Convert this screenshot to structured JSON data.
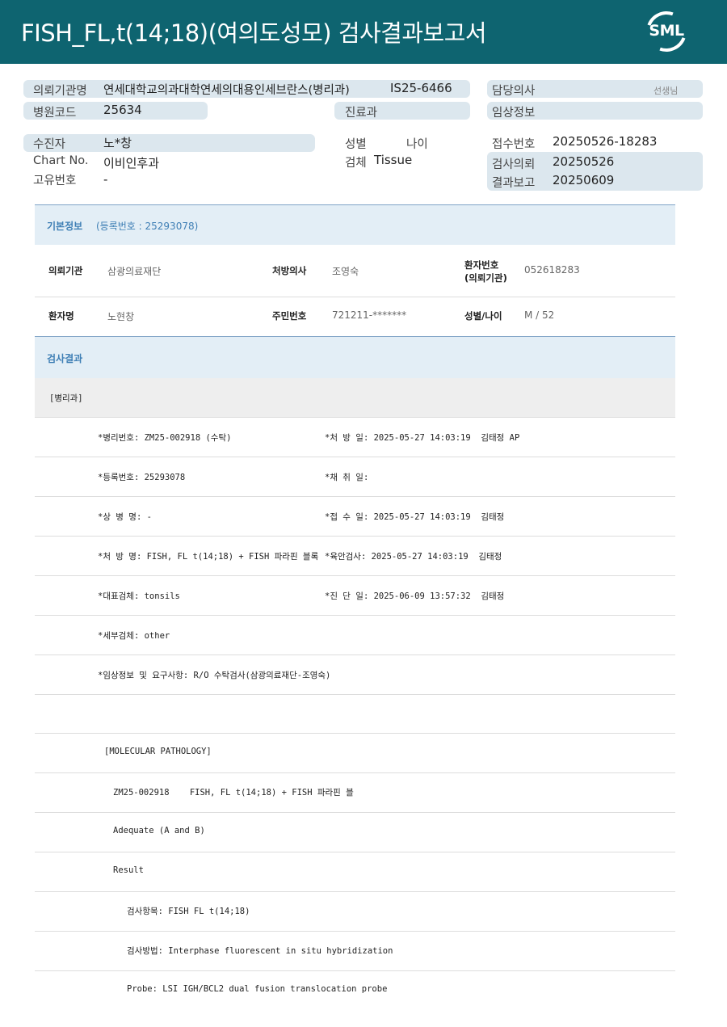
{
  "header": {
    "title": "FISH_FL,t(14;18)(여의도성모) 검사결과보고서",
    "logo_text": "SML"
  },
  "info": {
    "requesting_org_label": "의뢰기관명",
    "requesting_org_value": "연세대학교의과대학연세의대용인세브란스(병리과)",
    "request_code": "IS25-6466",
    "doctor_label": "담당의사",
    "doctor_suffix": "선생님",
    "hospital_code_label": "병원코드",
    "hospital_code_value": "25634",
    "dept_label": "진료과",
    "clinical_info_label": "임상정보",
    "patient_label": "수진자",
    "patient_value": "노*창",
    "sex_label": "성별",
    "age_label": "나이",
    "receipt_no_label": "접수번호",
    "receipt_no_value": "20250526-18283",
    "chart_label": "Chart No.",
    "chart_value": "이비인후과",
    "specimen_label": "검체",
    "specimen_value": "Tissue",
    "test_request_label": "검사의뢰",
    "test_request_value": "20250526",
    "unique_no_label": "고유번호",
    "unique_no_value": "-",
    "result_report_label": "결과보고",
    "result_report_value": "20250609"
  },
  "basic": {
    "title": "기본정보",
    "reg_note": "(등록번호 : 25293078)",
    "org_label": "의뢰기관",
    "org_value": "삼광의료재단",
    "prescriber_label": "처방의사",
    "prescriber_value": "조영숙",
    "patient_no_label_1": "환자번호",
    "patient_no_label_2": "(의뢰기관)",
    "patient_no_value": "052618283",
    "name_label": "환자명",
    "name_value": "노현창",
    "rrn_label": "주민번호",
    "rrn_value": "721211-*******",
    "sex_age_label": "성별/나이",
    "sex_age_value": "M / 52"
  },
  "results": {
    "title": "검사결과",
    "section_label": "[병리과]",
    "rows": [
      {
        "left": "*병리번호: ZM25-002918 (수탁)",
        "right": "*처 방 일: 2025-05-27 14:03:19  김태정 AP"
      },
      {
        "left": "*등록번호: 25293078",
        "right": "*채 취 일:"
      },
      {
        "left": "*상 병 명: -",
        "right": "*접 수 일: 2025-05-27 14:03:19  김태정"
      },
      {
        "left": "*처 방 명: FISH, FL t(14;18) + FISH 파라핀 블록",
        "right": "*육안검사: 2025-05-27 14:03:19  김태정"
      },
      {
        "left": "*대표검체: tonsils",
        "right": "*진 단 일: 2025-06-09 13:57:32  김태정"
      },
      {
        "left": "*세부검체: other",
        "right": ""
      },
      {
        "left": "*임상정보 및 요구사항: R/O 수탁검사(삼광의료재단-조영숙)",
        "right": ""
      }
    ],
    "mol_title": "[MOLECULAR PATHOLOGY]",
    "mol_line": "ZM25-002918    FISH, FL t(14;18) + FISH 파라핀 블",
    "adequate": "Adequate (A and B)",
    "result_label": "Result",
    "test_item": "검사항목: FISH FL t(14;18)",
    "test_method": "검사방법: Interphase fluorescent in situ hybridization",
    "probe": "Probe: LSI IGH/BCL2 dual fusion translocation probe"
  }
}
